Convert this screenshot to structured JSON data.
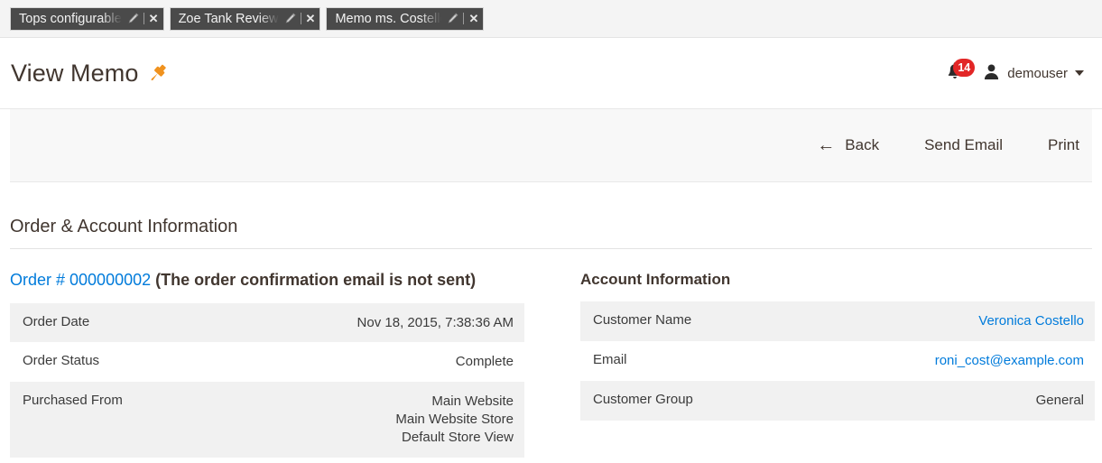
{
  "tabs": [
    {
      "label": "Tops configurable",
      "edit_icon": "pencil-icon",
      "close_icon": "close-icon"
    },
    {
      "label": "Zoe Tank Review",
      "edit_icon": "pencil-icon",
      "close_icon": "close-icon"
    },
    {
      "label": "Memo ms. Costello",
      "edit_icon": "pencil-icon",
      "close_icon": "close-icon"
    }
  ],
  "header": {
    "title": "View Memo",
    "pin_icon": "pushpin-icon",
    "bell_icon": "bell-icon",
    "notification_count": "14",
    "user_icon": "user-icon",
    "user_name": "demouser",
    "caret_icon": "chevron-down-icon"
  },
  "toolbar": {
    "back_arrow": "←",
    "back_label": "Back",
    "send_email_label": "Send Email",
    "print_label": "Print"
  },
  "section": {
    "title": "Order & Account Information"
  },
  "order": {
    "link_text": "Order # 000000002",
    "note": " (The order confirmation email is not sent)",
    "rows": [
      {
        "label": "Order Date",
        "value": "Nov 18, 2015, 7:38:36 AM"
      },
      {
        "label": "Order Status",
        "value": "Complete"
      },
      {
        "label": "Purchased From",
        "value": [
          "Main Website",
          "Main Website Store",
          "Default Store View"
        ]
      }
    ]
  },
  "account": {
    "title": "Account Information",
    "rows": [
      {
        "label": "Customer Name",
        "value": "Veronica Costello",
        "link": true
      },
      {
        "label": "Email",
        "value": "roni_cost@example.com",
        "link": true
      },
      {
        "label": "Customer Group",
        "value": "General",
        "link": false
      }
    ]
  },
  "colors": {
    "link": "#007bdb",
    "badge": "#e22626",
    "tab_bg": "#4a4a4a",
    "pin": "#f0921e"
  }
}
